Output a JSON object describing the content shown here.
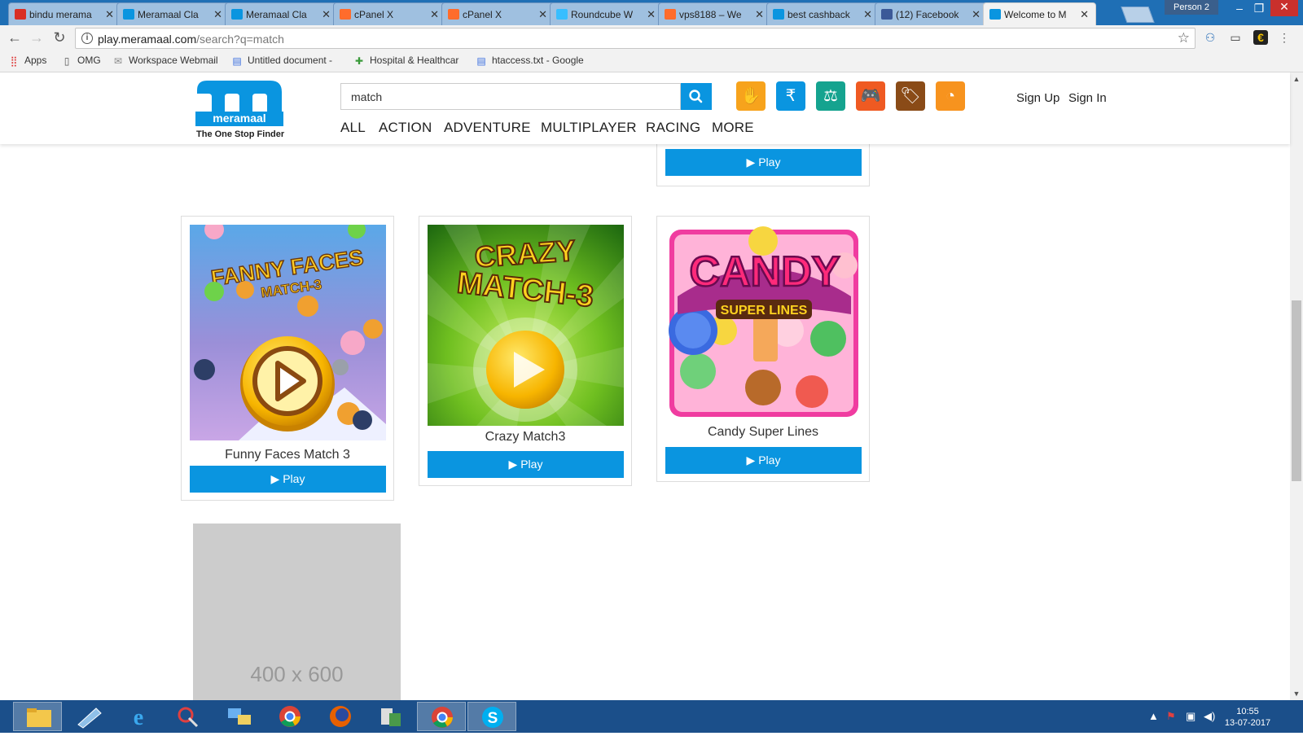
{
  "browser": {
    "tabs": [
      {
        "title": "bindu merama",
        "icon": "gmail-icon",
        "color": "#d93025"
      },
      {
        "title": "Meramaal Cla",
        "icon": "meramaal-icon",
        "color": "#0a95e0"
      },
      {
        "title": "Meramaal Cla",
        "icon": "meramaal-icon",
        "color": "#0a95e0"
      },
      {
        "title": "cPanel X",
        "icon": "cpanel-icon",
        "color": "#ff6c2c"
      },
      {
        "title": "cPanel X",
        "icon": "cpanel-icon",
        "color": "#ff6c2c"
      },
      {
        "title": "Roundcube W",
        "icon": "roundcube-icon",
        "color": "#37beff"
      },
      {
        "title": "vps8188 – We",
        "icon": "cpanel-icon",
        "color": "#ff6c2c"
      },
      {
        "title": "best cashback",
        "icon": "meramaal-icon",
        "color": "#0a95e0"
      },
      {
        "title": "(12) Facebook",
        "icon": "facebook-icon",
        "color": "#3b5998"
      },
      {
        "title": "Welcome to M",
        "icon": "meramaal-icon",
        "color": "#0a95e0"
      }
    ],
    "active_tab": 9,
    "profile": "Person 2",
    "url_host": "play.meramaal.com",
    "url_path": "/search?q=match",
    "bookmarks": [
      {
        "label": "Apps",
        "icon": "apps-grid-icon"
      },
      {
        "label": "OMG",
        "icon": "page-icon"
      },
      {
        "label": "Workspace Webmail",
        "icon": "webmail-icon"
      },
      {
        "label": "Untitled document - ",
        "icon": "docs-icon"
      },
      {
        "label": "Hospital & Healthcar",
        "icon": "hospital-icon"
      },
      {
        "label": "htaccess.txt - Google",
        "icon": "docs-icon"
      }
    ]
  },
  "site": {
    "logo_letter": "m",
    "logo_word": "meramaal",
    "tagline": "The One Stop Finder",
    "search_value": "match",
    "categories": [
      "ALL",
      "ACTION",
      "ADVENTURE",
      "MULTIPLAYER",
      "RACING",
      "MORE"
    ],
    "sign_up": "Sign Up",
    "sign_in": "Sign In",
    "category_icons": [
      {
        "name": "classifieds-icon",
        "color": "#f7a31c"
      },
      {
        "name": "cashback-icon",
        "color": "#0a95e0"
      },
      {
        "name": "jobs-icon",
        "color": "#15a38f"
      },
      {
        "name": "games-icon",
        "color": "#ef5a22"
      },
      {
        "name": "coupons-icon",
        "color": "#8a4b17"
      },
      {
        "name": "blog-icon",
        "color": "#f7931e"
      }
    ]
  },
  "games": [
    {
      "title": "Funny Faces Match 3",
      "play": "▶ Play",
      "thumb_text_1": "FANNY FACES",
      "thumb_text_2": "MATCH-3"
    },
    {
      "title": "Crazy Match3",
      "play": "▶ Play",
      "thumb_text_1": "CRAZY",
      "thumb_text_2": "MATCH-3"
    },
    {
      "title": "Candy Super Lines",
      "play": "▶ Play",
      "thumb_text_1": "CANDY",
      "thumb_text_2": "SUPER LINES"
    }
  ],
  "partial_card_play": "▶ Play",
  "ad_placeholder": "400 x 600",
  "taskbar": {
    "time": "10:55",
    "date": "13-07-2017"
  }
}
